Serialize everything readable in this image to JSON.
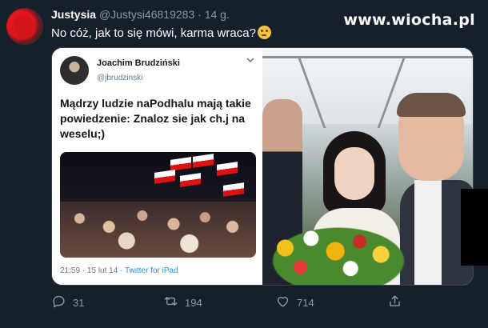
{
  "tweet": {
    "author_name": "Justysia",
    "author_handle": "@Justysi46819283",
    "separator": "·",
    "time": "14 g.",
    "text": "No cóż, jak to się mówi, karma wraca?"
  },
  "watermark": "www.wiocha.pl",
  "quoted_tweet": {
    "author_name": "Joachim Brudziński",
    "author_handle": "@jbrudzinski",
    "text": "Mądrzy ludzie naPodhalu mają takie powiedzenie: Znaloz sie jak ch.j  na weselu;)",
    "timestamp": "21:59 · 15 lut 14 · ",
    "source": "Twitter for iPad"
  },
  "actions": {
    "reply_count": "31",
    "retweet_count": "194",
    "like_count": "714"
  },
  "icons": {
    "reply": "reply-icon",
    "retweet": "retweet-icon",
    "like": "heart-icon",
    "share": "share-icon",
    "emoji": "thinking-face-emoji"
  },
  "colors": {
    "background": "#15202b",
    "secondary_text": "#8899a6",
    "link": "#1b95e0"
  }
}
